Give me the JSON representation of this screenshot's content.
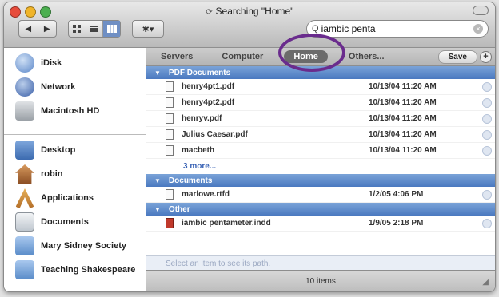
{
  "window": {
    "title": "Searching \"Home\"",
    "status": "10 items",
    "traffic_lights": [
      "#e74c3c",
      "#f0b429",
      "#4caf50"
    ]
  },
  "toolbar": {
    "back_label": "◀",
    "forward_label": "▶",
    "view_icon": "icon-view-icon",
    "list_icon": "list-view-icon",
    "column_icon": "column-view-icon",
    "action_label": "✱▾"
  },
  "search": {
    "value": "iambic penta"
  },
  "scope": {
    "items": [
      "Servers",
      "Computer",
      "Home",
      "Others..."
    ],
    "active": "Home",
    "save_label": "Save",
    "add_label": "+"
  },
  "sidebar": {
    "devices": [
      {
        "label": "iDisk",
        "color": "#5a86c8"
      },
      {
        "label": "Network",
        "color": "#3a5fa8"
      },
      {
        "label": "Macintosh HD",
        "color": "#9aa0a6"
      }
    ],
    "places": [
      {
        "label": "Desktop",
        "color": "#4a7fc1"
      },
      {
        "label": "robin",
        "color": "#b5713c"
      },
      {
        "label": "Applications",
        "color": "#c0862f"
      },
      {
        "label": "Documents",
        "color": "#cfd6dd"
      },
      {
        "label": "Mary Sidney Society",
        "color": "#6f9fd6"
      },
      {
        "label": "Teaching Shakespeare",
        "color": "#6f9fd6"
      }
    ]
  },
  "groups": [
    {
      "header": "PDF Documents",
      "rows": [
        {
          "name": "henry4pt1.pdf",
          "date": "10/13/04 11:20 AM"
        },
        {
          "name": "henry4pt2.pdf",
          "date": "10/13/04 11:20 AM"
        },
        {
          "name": "henryv.pdf",
          "date": "10/13/04 11:20 AM"
        },
        {
          "name": "Julius Caesar.pdf",
          "date": "10/13/04 11:20 AM"
        },
        {
          "name": "macbeth",
          "date": "10/13/04 11:20 AM"
        }
      ],
      "more": "3 more..."
    },
    {
      "header": "Documents",
      "rows": [
        {
          "name": "marlowe.rtfd",
          "date": "1/2/05 4:06 PM"
        }
      ]
    },
    {
      "header": "Other",
      "rows": [
        {
          "name": "iambic pentameter.indd",
          "date": "1/9/05 2:18 PM"
        }
      ]
    }
  ],
  "pathbar": "Select an item to see its path.",
  "highlight_color": "#6a2c8d"
}
